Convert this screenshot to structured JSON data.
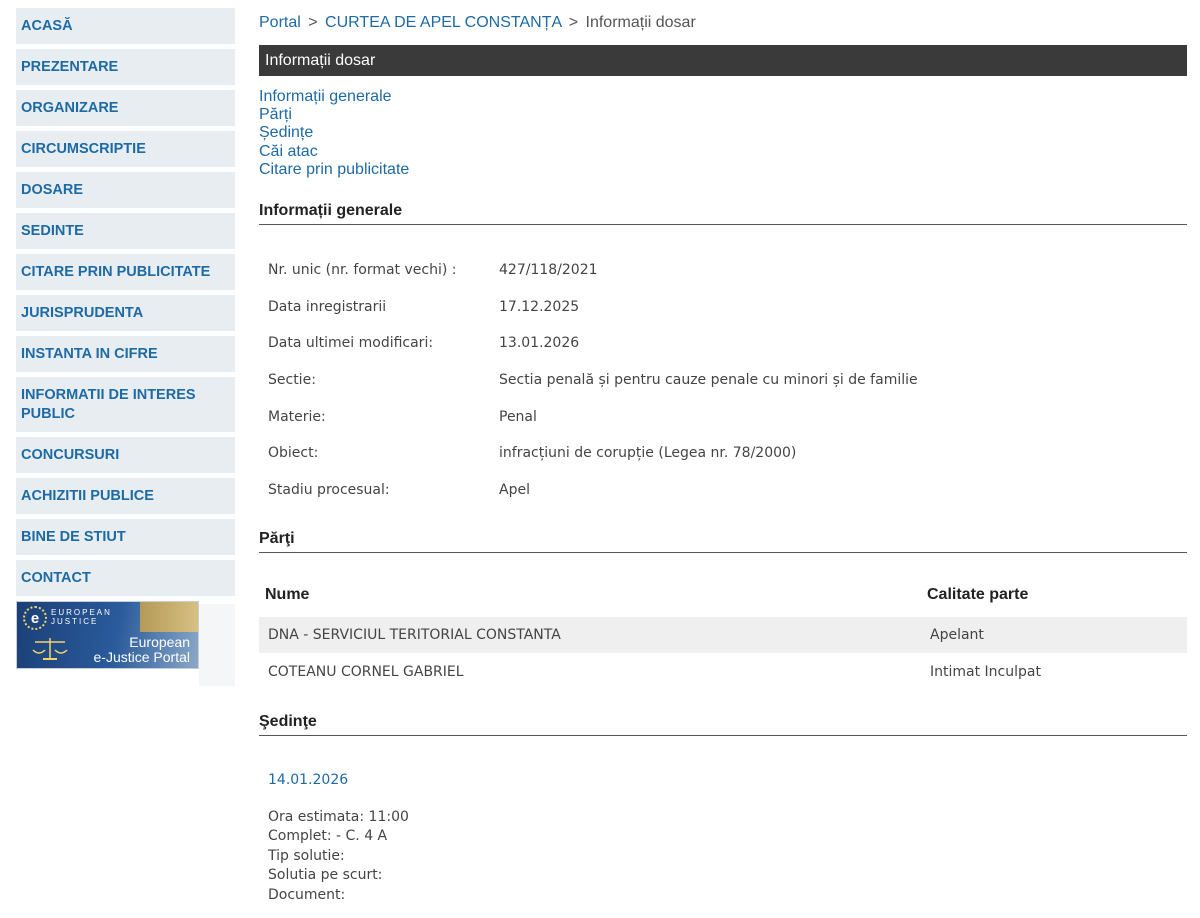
{
  "sidebar": {
    "items": [
      {
        "label": "ACASĂ"
      },
      {
        "label": "PREZENTARE"
      },
      {
        "label": "ORGANIZARE"
      },
      {
        "label": "CIRCUMSCRIPTIE"
      },
      {
        "label": "DOSARE"
      },
      {
        "label": "SEDINTE"
      },
      {
        "label": "CITARE PRIN PUBLICITATE"
      },
      {
        "label": "JURISPRUDENTA"
      },
      {
        "label": "INSTANTA IN CIFRE"
      },
      {
        "label": "INFORMATII DE INTERES PUBLIC"
      },
      {
        "label": "CONCURSURI"
      },
      {
        "label": "ACHIZITII PUBLICE"
      },
      {
        "label": "BINE DE STIUT"
      },
      {
        "label": "CONTACT"
      }
    ],
    "banner": {
      "logo_letter": "e",
      "small_line1": "European",
      "small_line2": "Justice",
      "big_line1": "European",
      "big_line2": "e-Justice Portal"
    }
  },
  "breadcrumb": {
    "portal": "Portal",
    "court": "CURTEA DE APEL CONSTANȚA",
    "current": "Informații dosar",
    "separator": ">"
  },
  "title_bar": "Informații dosar",
  "section_links": [
    "Informații generale",
    "Părți",
    "Ședințe",
    "Căi atac",
    "Citare prin publicitate"
  ],
  "general": {
    "heading": "Informații generale",
    "rows": [
      {
        "label": "Nr. unic (nr. format vechi) :",
        "value": "427/118/2021"
      },
      {
        "label": "Data inregistrarii",
        "value": "17.12.2025"
      },
      {
        "label": "Data ultimei modificari:",
        "value": "13.01.2026"
      },
      {
        "label": "Sectie:",
        "value": "Sectia penală și pentru cauze penale cu minori și de familie"
      },
      {
        "label": "Materie:",
        "value": "Penal"
      },
      {
        "label": "Obiect:",
        "value": "infracțiuni de corupție (Legea nr. 78/2000)"
      },
      {
        "label": "Stadiu procesual:",
        "value": "Apel"
      }
    ]
  },
  "parties": {
    "heading": "Părţi",
    "col_name": "Nume",
    "col_role": "Calitate parte",
    "rows": [
      {
        "name": "DNA - SERVICIUL TERITORIAL CONSTANTA",
        "role": "Apelant"
      },
      {
        "name": "COTEANU CORNEL GABRIEL",
        "role": "Intimat Inculpat"
      }
    ]
  },
  "hearings": {
    "heading": "Şedinţe",
    "date": "14.01.2026",
    "lines": [
      "Ora estimata: 11:00",
      "Complet: - C. 4 A",
      "Tip solutie:",
      "Solutia pe scurt:",
      "Document:"
    ]
  }
}
